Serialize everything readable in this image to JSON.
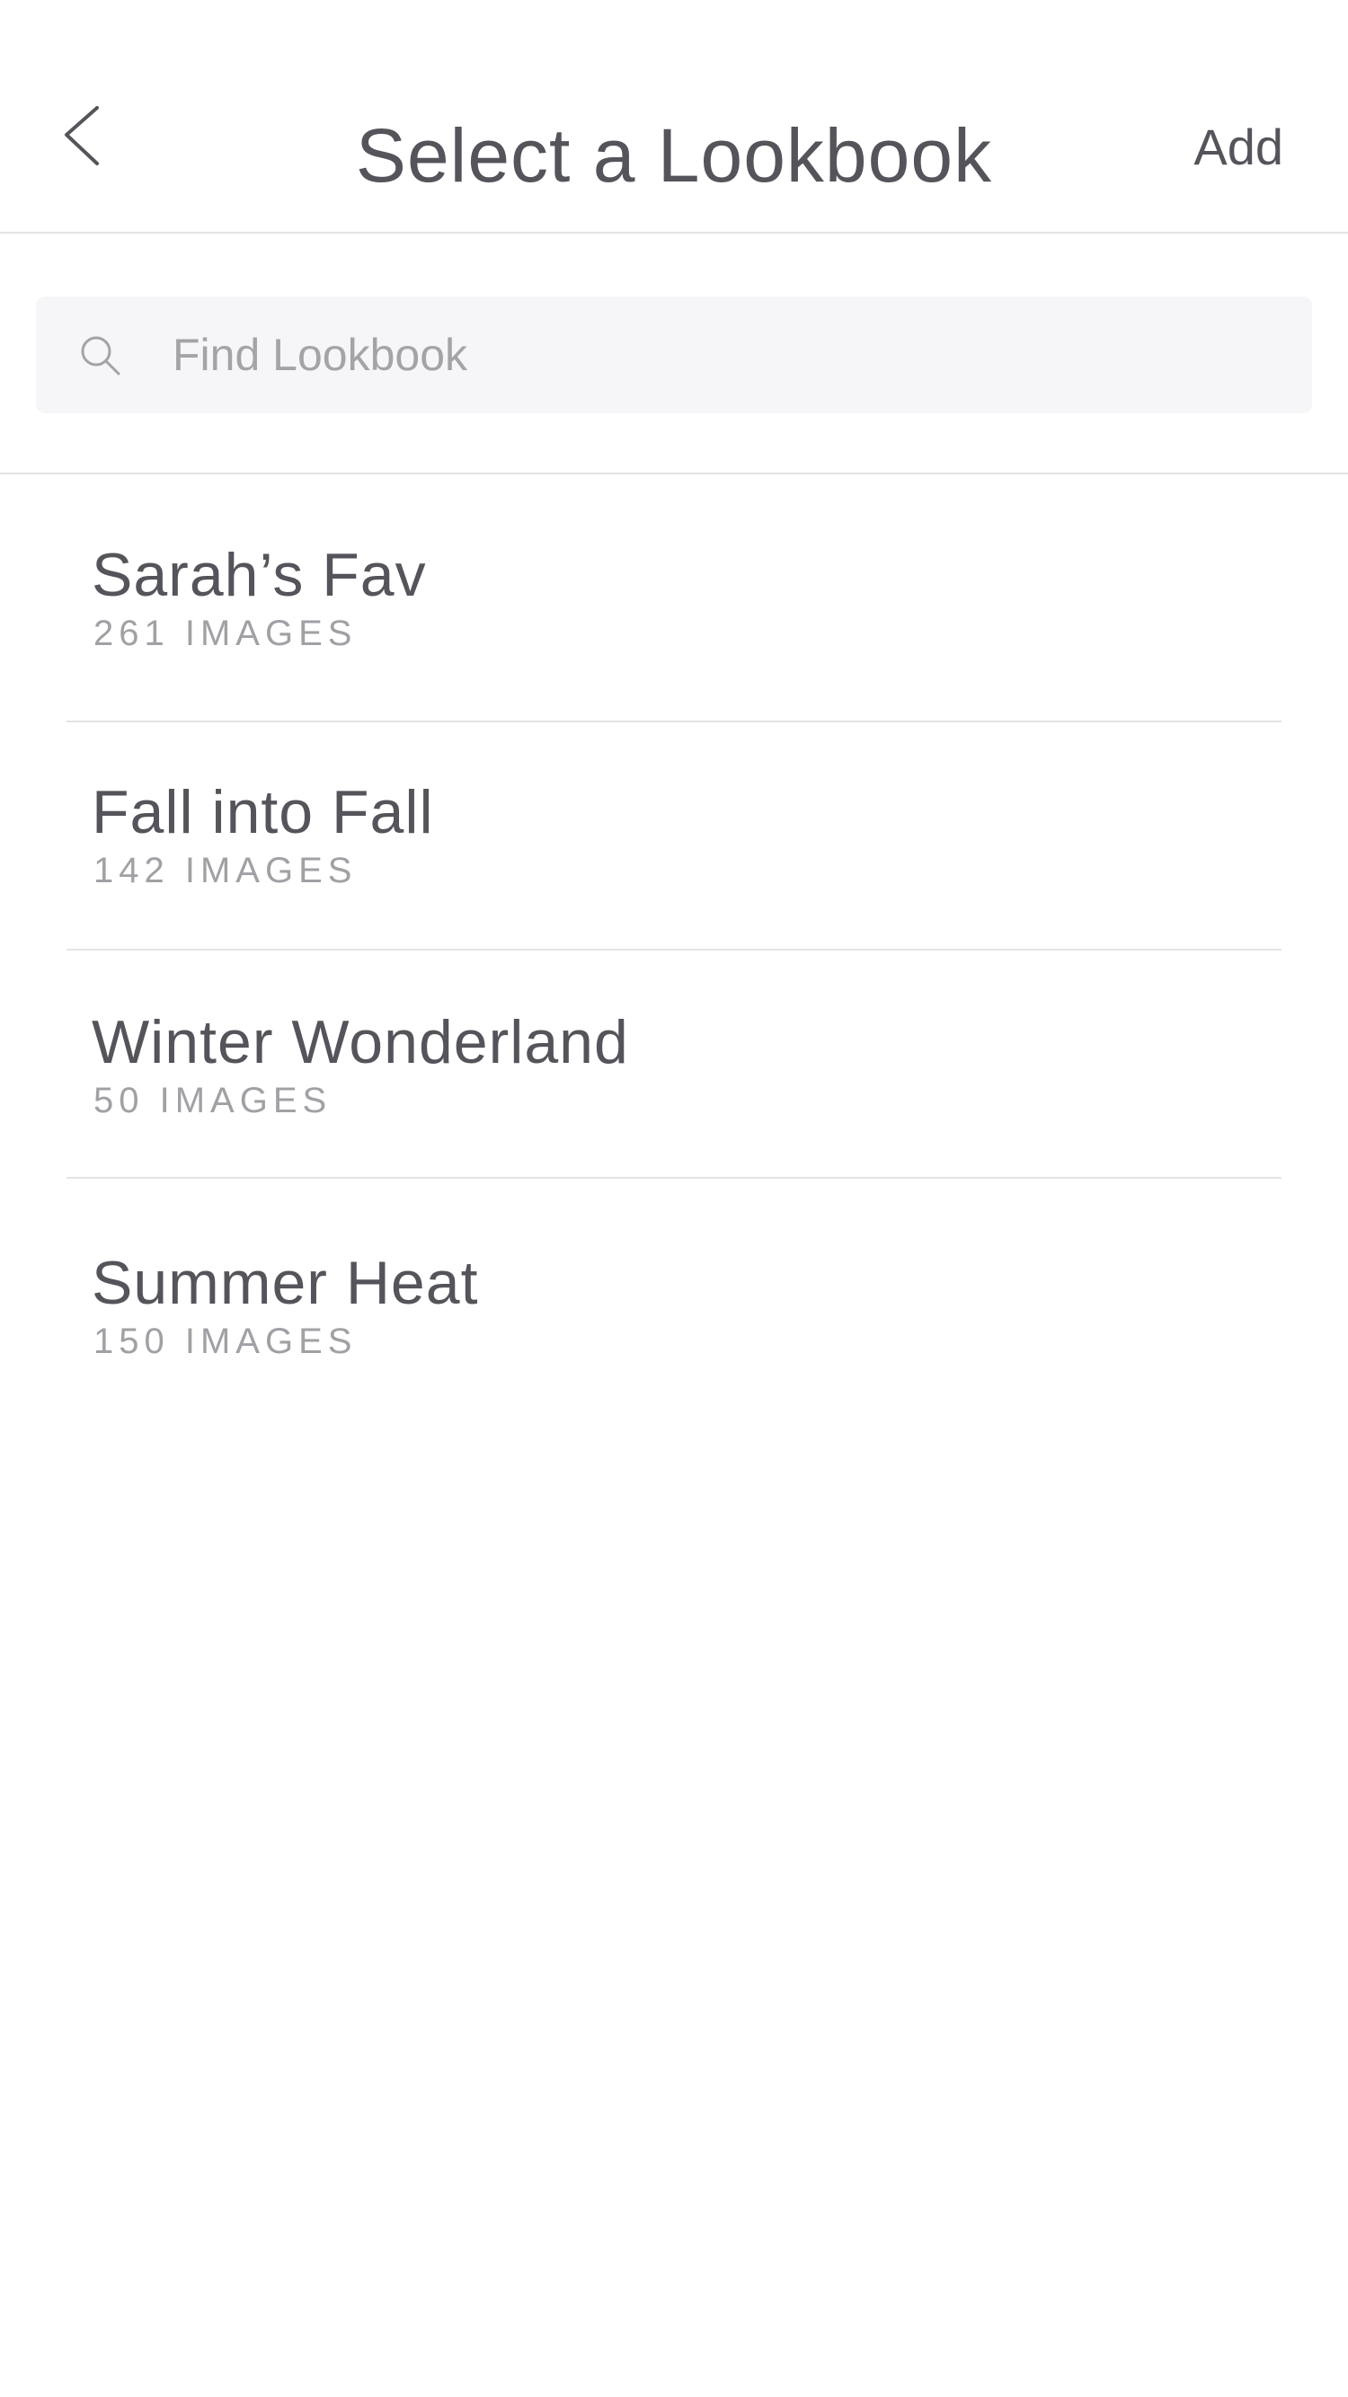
{
  "header": {
    "title": "Select a Lookbook",
    "add_label": "Add",
    "back_icon": "chevron-left-icon"
  },
  "search": {
    "placeholder": "Find Lookbook",
    "value": "",
    "icon": "search-icon"
  },
  "lookbooks": [
    {
      "name": "Sarah’s Fav",
      "count": "261 IMAGES"
    },
    {
      "name": "Fall into Fall",
      "count": "142 IMAGES"
    },
    {
      "name": "Winter Wonderland",
      "count": "50 IMAGES"
    },
    {
      "name": "Summer Heat",
      "count": "150 IMAGES"
    }
  ],
  "colors": {
    "text_primary": "#55545b",
    "text_secondary": "#a0a0a5",
    "divider": "#e3e3e6",
    "search_background": "#f6f6f8"
  }
}
